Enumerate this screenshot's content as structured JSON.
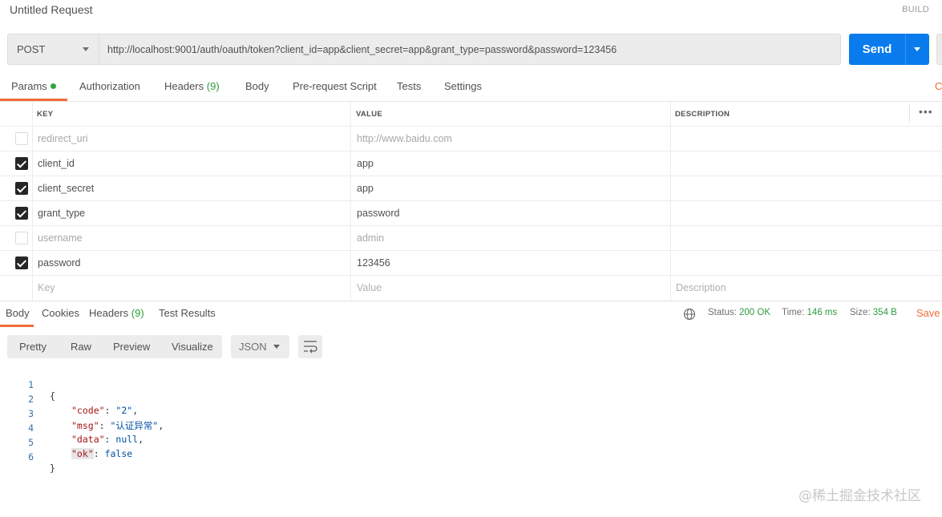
{
  "header": {
    "title": "Untitled Request",
    "build_label": "BUILD"
  },
  "request": {
    "method": "POST",
    "url": "http://localhost:9001/auth/oauth/token?client_id=app&client_secret=app&grant_type=password&password=123456",
    "send_label": "Send"
  },
  "tabs": {
    "params": "Params",
    "authorization": "Authorization",
    "headers": "Headers",
    "headers_count": "(9)",
    "body": "Body",
    "prerequest": "Pre-request Script",
    "tests": "Tests",
    "settings": "Settings",
    "cookies": "C"
  },
  "params_table": {
    "columns": {
      "key": "KEY",
      "value": "VALUE",
      "description": "DESCRIPTION"
    },
    "rows": [
      {
        "key": "redirect_uri",
        "value": "http://www.baidu.com",
        "checked": false
      },
      {
        "key": "client_id",
        "value": "app",
        "checked": true
      },
      {
        "key": "client_secret",
        "value": "app",
        "checked": true
      },
      {
        "key": "grant_type",
        "value": "password",
        "checked": true
      },
      {
        "key": "username",
        "value": "admin",
        "checked": false
      },
      {
        "key": "password",
        "value": "123456",
        "checked": true
      }
    ],
    "placeholders": {
      "key": "Key",
      "value": "Value",
      "description": "Description"
    }
  },
  "response": {
    "tabs": {
      "body": "Body",
      "cookies": "Cookies",
      "headers": "Headers",
      "headers_count": "(9)",
      "test_results": "Test Results"
    },
    "status_label": "Status:",
    "status_value": "200 OK",
    "time_label": "Time:",
    "time_value": "146 ms",
    "size_label": "Size:",
    "size_value": "354 B",
    "save_label": "Save R",
    "view_modes": [
      "Pretty",
      "Raw",
      "Preview",
      "Visualize"
    ],
    "format": "JSON",
    "body_lines": [
      {
        "n": "1",
        "text": "{"
      },
      {
        "n": "2",
        "key": "\"code\"",
        "val": "\"2\"",
        "end": ","
      },
      {
        "n": "3",
        "key": "\"msg\"",
        "val": "\"认证异常\"",
        "end": ","
      },
      {
        "n": "4",
        "key": "\"data\"",
        "val": "null",
        "end": ","
      },
      {
        "n": "5",
        "key": "\"ok\"",
        "val": "false",
        "end": ""
      },
      {
        "n": "6",
        "text": "}"
      }
    ]
  },
  "watermark": "@稀土掘金技术社区",
  "colors": {
    "accent": "#f26b3a",
    "send": "#097bed",
    "success": "#2d9c3c"
  }
}
